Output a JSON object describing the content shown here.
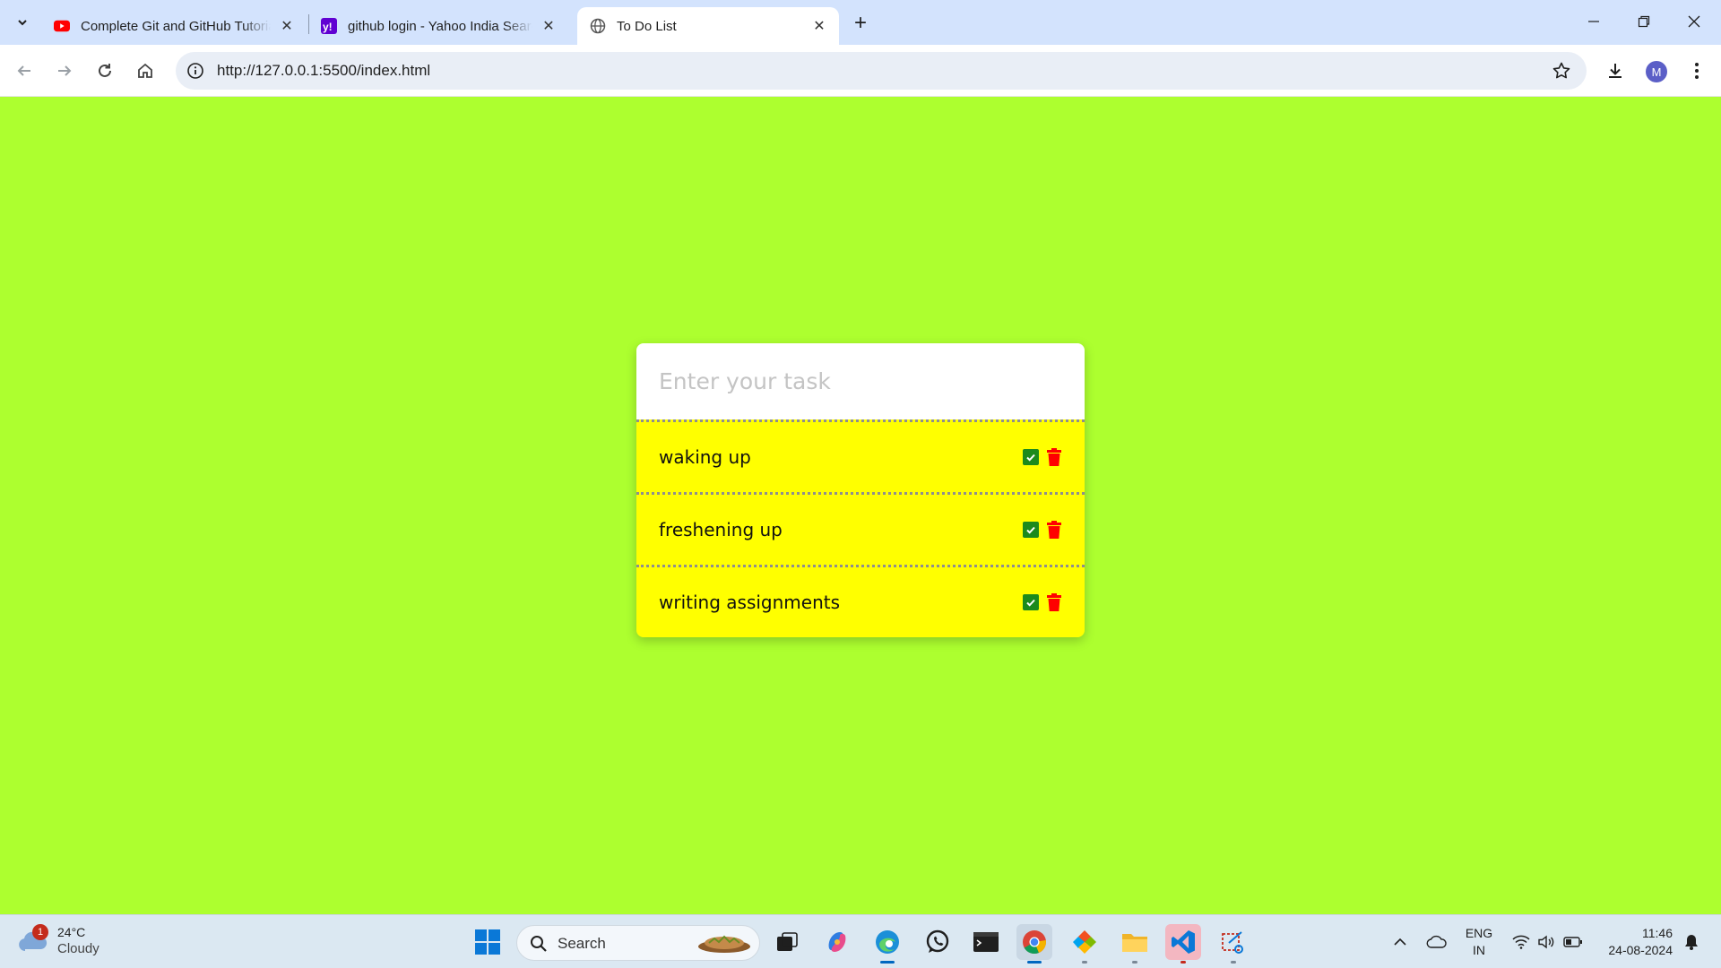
{
  "browser": {
    "tabs": [
      {
        "title": "Complete Git and GitHub Tutorial",
        "favicon": "youtube-icon"
      },
      {
        "title": "github login - Yahoo India Search Results",
        "favicon": "yahoo-icon"
      },
      {
        "title": "To Do List",
        "favicon": "globe-icon",
        "active": true
      }
    ],
    "url": "http://127.0.0.1:5500/index.html",
    "profile_initial": "M"
  },
  "todo": {
    "placeholder": "Enter your task",
    "items": [
      {
        "text": "waking up"
      },
      {
        "text": "freshening up"
      },
      {
        "text": "writing assignments"
      }
    ],
    "colors": {
      "page_bg": "#adff2f",
      "item_bg": "#ffff00",
      "check": "#1c8a1c",
      "trash": "#ff0000"
    }
  },
  "taskbar": {
    "weather": {
      "badge": "1",
      "temp": "24°C",
      "condition": "Cloudy"
    },
    "search_label": "Search",
    "lang_line1": "ENG",
    "lang_line2": "IN",
    "time": "11:46",
    "date": "24-08-2024"
  }
}
